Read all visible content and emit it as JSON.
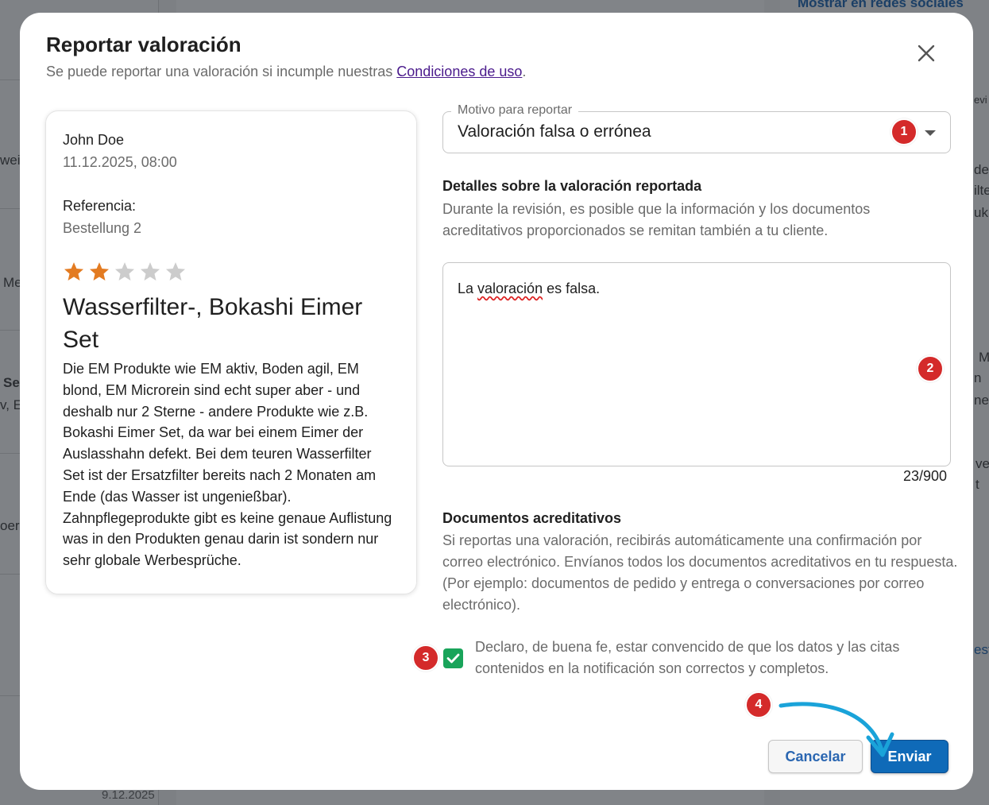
{
  "background": {
    "link_text": "Mostrar en redes sociales",
    "date_text": "9.12.2025",
    "fragments": [
      "wei",
      "Me",
      "Se",
      "v, E",
      "oer",
      "M",
      "n",
      "ne",
      "ve",
      "t",
      "de",
      "ilte",
      "uk",
      "evi",
      "est"
    ]
  },
  "dialog": {
    "title": "Reportar valoración",
    "subtitle": "Se puede reportar una valoración si incumple nuestras",
    "terms_link": "Condiciones de uso",
    "subtitle_end": ".",
    "close_icon": "close-icon"
  },
  "review": {
    "author": "John Doe",
    "date": "11.12.2025, 08:00",
    "reference_label": "Referencia:",
    "reference_value": "Bestellung 2",
    "rating": 2,
    "rating_max": 5,
    "star_color_filled": "#e37b21",
    "star_color_empty": "#cccccc",
    "product": "Wasserfilter-, Bokashi Eimer Set",
    "text": "Die EM Produkte wie EM aktiv, Boden agil, EM blond, EM Microrein sind echt super aber - und deshalb nur 2 Sterne - andere Produkte wie z.B. Bokashi Eimer Set, da war bei einem Eimer der Auslasshahn defekt. Bei dem teuren Wasserfilter Set ist der Ersatzfilter bereits nach 2 Monaten am Ende (das Wasser ist ungenießbar). Zahnpflegeprodukte gibt es keine genaue Auflistung was in den Produkten genau darin ist sondern nur sehr globale Werbesprüche."
  },
  "form": {
    "reason_label": "Motivo para reportar",
    "reason_value": "Valoración falsa o errónea",
    "details_heading": "Detalles sobre la valoración reportada",
    "details_help": "Durante la revisión, es posible que la información y los documentos acreditativos proporcionados se remitan también a tu cliente.",
    "details_text_before": "La ",
    "details_text_spell": "valoración",
    "details_text_after": " es falsa.",
    "counter": "23/900",
    "docs_heading": "Documentos acreditativos",
    "docs_help": "Si reportas una valoración, recibirás automáticamente una confirmación por correo electrónico. Envíanos todos los documentos acreditativos en tu respuesta. (Por ejemplo: documentos de pedido y entrega o conversaciones por correo electrónico).",
    "declaration_checked": true,
    "declaration": "Declaro, de buena fe, estar convencido de que los datos y las citas contenidos en la notificación son correctos y completos.",
    "cancel_label": "Cancelar",
    "submit_label": "Enviar"
  },
  "markers": [
    "1",
    "2",
    "3",
    "4"
  ],
  "colors": {
    "accent": "#0f6ab8",
    "checkbox": "#19a45a",
    "marker": "#d42a2a",
    "arrow": "#1aa3d9"
  }
}
